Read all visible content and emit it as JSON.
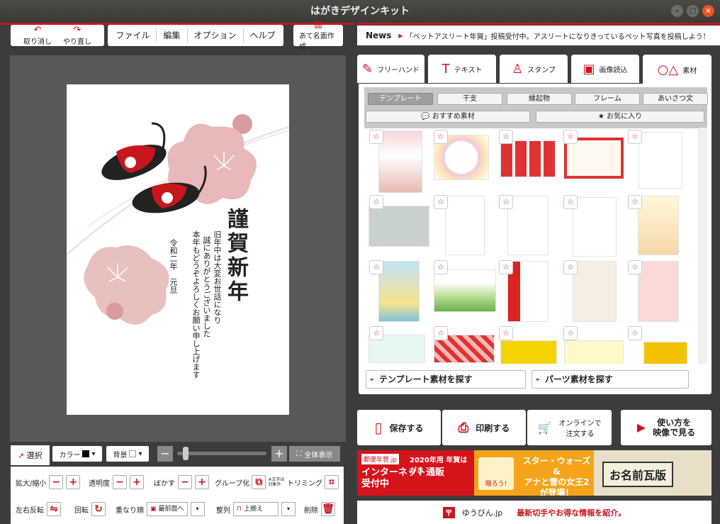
{
  "window": {
    "title": "はがきデザインキット",
    "min": "–",
    "max": "□",
    "close": "×"
  },
  "toolbar": {
    "undo": "取り消し",
    "redo": "やり直し",
    "menu": [
      "ファイル",
      "編集",
      "オプション",
      "ヘルプ"
    ],
    "address": "あて名面作成"
  },
  "news": {
    "label": "News",
    "text": "「ペットアスリート年賀」投稿受付中。アスリートになりきっているペット写真を投稿しよう！"
  },
  "card": {
    "title": "謹賀新年",
    "line1": "旧年中は大変お世話になり",
    "line2": "誠にありがとうございました",
    "line3": "本年もどうぞよろしくお願い申し上げます",
    "date": "令和二年　元旦"
  },
  "tabs": [
    "フリーハンド",
    "テキスト",
    "スタンプ",
    "画像読込",
    "素材"
  ],
  "categories": [
    "テンプレート",
    "干支",
    "縁起物",
    "フレーム",
    "あいさつ文"
  ],
  "categories2": [
    "おすすめ素材",
    "お気に入り"
  ],
  "find": {
    "template": "テンプレート素材を探す",
    "parts": "パーツ素材を探す"
  },
  "actions": {
    "save": "保存する",
    "print": "印刷する",
    "online": "オンラインで\n注文する",
    "howto": "使い方を\n映像で見る"
  },
  "banners": {
    "b1a": "郵便年賀.jp",
    "b1b": "2020年用 年賀はがき",
    "b1c": "インターネット通販\n受付中",
    "b2": "スター・ウォーズ&\nアナと雪の女王2\nが登場！",
    "b2small": "贈ろう!",
    "b3": "お名前瓦版",
    "bottom_logo": "ゆうびん.jp",
    "bottom_text": "最新切手やお得な情報を紹介。"
  },
  "tools": {
    "select": "選択",
    "color": "カラー",
    "bg": "背景",
    "fit": "全体表示",
    "scale": "拡大/縮小",
    "opacity": "透明度",
    "blur": "ぼかす",
    "group": "グループ化",
    "groupnote": "※文字は\n対象外",
    "trim": "トリミング",
    "flip": "左右反転",
    "rotate": "回転",
    "order": "重なり順",
    "front": "最前面へ",
    "align": "整列",
    "top": "上揃え",
    "delete": "削除"
  }
}
